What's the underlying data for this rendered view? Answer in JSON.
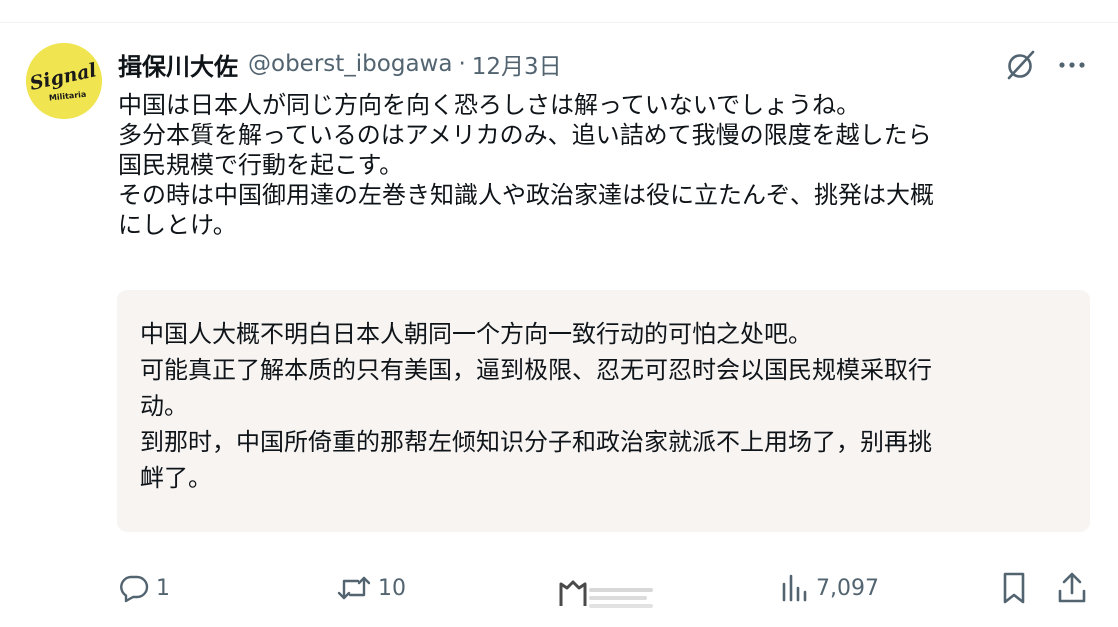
{
  "tweet": {
    "display_name": "揖保川大佐",
    "handle": "@oberst_ibogawa",
    "separator": "·",
    "timestamp": "12月3日",
    "avatar": {
      "text_top": "Signal",
      "text_bottom": "Militaria",
      "background": "#f0e450"
    },
    "text_lines": [
      "中国は日本人が同じ方向を向く恐ろしさは解っていないでしょうね。",
      "多分本質を解っているのはアメリカのみ、追い詰めて我慢の限度を越したら",
      "国民規模で行動を起こす。",
      "その時は中国御用達の左巻き知識人や政治家達は役に立たんぞ、挑発は大概",
      "にしとけ。"
    ],
    "translation_lines": [
      "中国人大概不明白日本人朝同一个方向一致行动的可怕之处吧。",
      "可能真正了解本质的只有美国，逼到极限、忍无可忍时会以国民规模采取行",
      "动。",
      "到那时，中国所倚重的那帮左倾知识分子和政治家就派不上用场了，别再挑",
      "衅了。"
    ]
  },
  "actions": {
    "reply_count": "1",
    "retweet_count": "10",
    "views_count": "7,097"
  },
  "icons": {
    "grok": "grok-slash-icon",
    "more": "more-dots-icon",
    "reply": "reply-bubble-icon",
    "retweet": "retweet-arrows-icon",
    "views": "views-bars-icon",
    "bookmark": "bookmark-icon",
    "share": "share-upload-icon"
  },
  "colors": {
    "text": "#0f1419",
    "secondary": "#536471",
    "translation_bg": "#f7f4f2"
  }
}
